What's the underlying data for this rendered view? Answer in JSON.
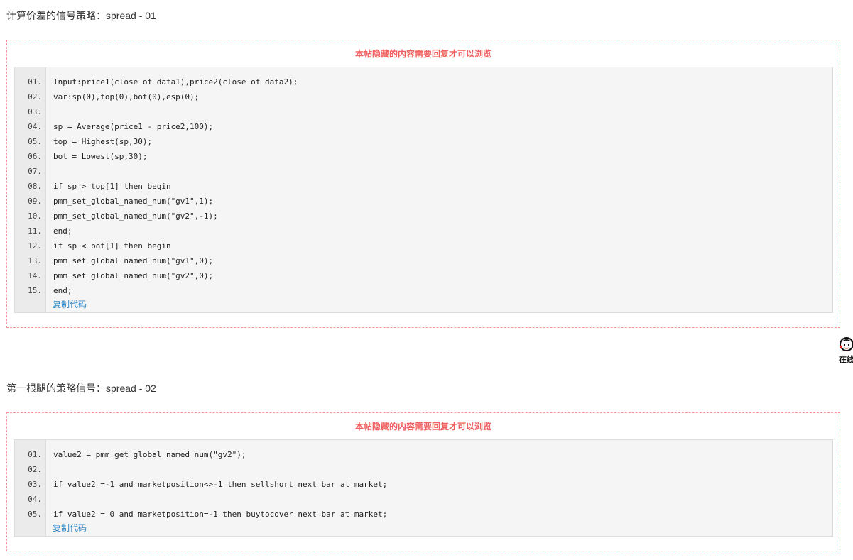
{
  "section1": {
    "title": "计算价差的信号策略：spread - 01",
    "notice": "本帖隐藏的内容需要回复才可以浏览",
    "copy_label": "复制代码",
    "lines": [
      {
        "n": "01.",
        "code": "Input:price1(close of data1),price2(close of data2);"
      },
      {
        "n": "02.",
        "code": "var:sp(0),top(0),bot(0),esp(0);"
      },
      {
        "n": "03.",
        "code": ""
      },
      {
        "n": "04.",
        "code": "sp = Average(price1 - price2,100);"
      },
      {
        "n": "05.",
        "code": "top = Highest(sp,30);"
      },
      {
        "n": "06.",
        "code": "bot = Lowest(sp,30);"
      },
      {
        "n": "07.",
        "code": ""
      },
      {
        "n": "08.",
        "code": "if sp > top[1] then begin"
      },
      {
        "n": "09.",
        "code": "pmm_set_global_named_num(\"gv1\",1);"
      },
      {
        "n": "10.",
        "code": "pmm_set_global_named_num(\"gv2\",-1);"
      },
      {
        "n": "11.",
        "code": "end;"
      },
      {
        "n": "12.",
        "code": "if sp < bot[1] then begin"
      },
      {
        "n": "13.",
        "code": "pmm_set_global_named_num(\"gv1\",0);"
      },
      {
        "n": "14.",
        "code": "pmm_set_global_named_num(\"gv2\",0);"
      },
      {
        "n": "15.",
        "code": "end;"
      }
    ]
  },
  "section2": {
    "title": "第一根腿的策略信号：spread - 02",
    "notice": "本帖隐藏的内容需要回复才可以浏览",
    "copy_label": "复制代码",
    "lines": [
      {
        "n": "01.",
        "code": "value2 = pmm_get_global_named_num(\"gv2\");"
      },
      {
        "n": "02.",
        "code": ""
      },
      {
        "n": "03.",
        "code": "if value2 =-1 and marketposition<>-1 then sellshort next bar at market;"
      },
      {
        "n": "04.",
        "code": ""
      },
      {
        "n": "05.",
        "code": "if value2 = 0 and marketposition=-1 then buytocover next bar at market;"
      }
    ]
  },
  "online_badge": {
    "text": "在线"
  }
}
